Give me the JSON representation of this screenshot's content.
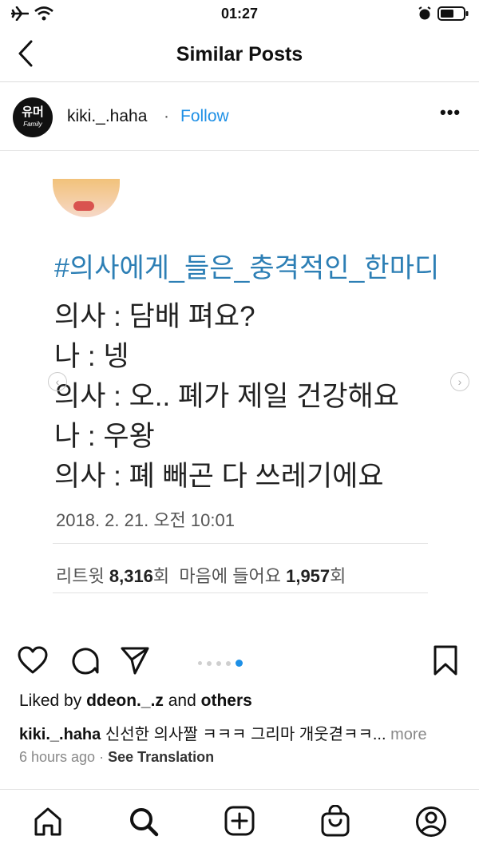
{
  "status_bar": {
    "time": "01:27"
  },
  "header": {
    "title": "Similar Posts"
  },
  "post": {
    "avatar_text_top": "유머",
    "avatar_text_bottom": "Family",
    "username": "kiki._.haha",
    "separator": "·",
    "follow_label": "Follow",
    "more_label": "•••",
    "tweet": {
      "hashtag": "#의사에게_들은_충격적인_한마디",
      "lines": [
        "의사 : 담배 펴요?",
        "나 : 넹",
        "의사 : 오.. 폐가 제일 건강해요",
        "나 : 우왕",
        "의사 : 폐 빼곤 다 쓰레기에요"
      ],
      "date": "2018. 2. 21. 오전 10:01",
      "retweet_label": "리트윗",
      "retweet_count": "8,316",
      "count_unit": "회",
      "like_label": "마음에 들어요",
      "like_count": "1,957"
    },
    "carousel": {
      "total_dots": 5,
      "active_index": 4
    },
    "liked_by_prefix": "Liked by",
    "liked_by_user": "ddeon._.z",
    "liked_by_and": "and",
    "liked_by_others": "others",
    "caption_user": "kiki._.haha",
    "caption_text": "신선한 의사짤 ㅋㅋㅋ 그리마 개웃겯ㅋㅋ...",
    "caption_more": "more",
    "time_ago": "6 hours ago",
    "meta_sep": "·",
    "see_translation": "See Translation"
  },
  "icons": {
    "airplane": "airplane-icon",
    "wifi": "wifi-icon",
    "alarm": "alarm-icon",
    "battery": "battery-icon",
    "back": "back-chevron-icon",
    "heart": "heart-icon",
    "comment": "comment-icon",
    "share": "send-icon",
    "bookmark": "bookmark-icon",
    "home": "home-icon",
    "search": "search-icon",
    "add": "add-post-icon",
    "shop": "shop-bag-icon",
    "profile": "profile-icon"
  },
  "colors": {
    "accent": "#1e90e6",
    "hashtag": "#2d7fb5"
  }
}
